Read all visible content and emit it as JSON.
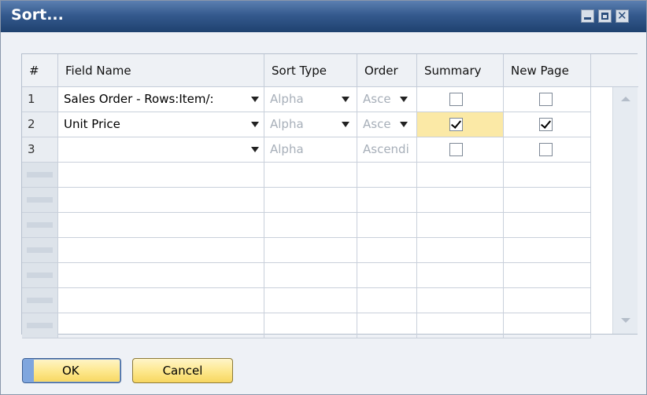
{
  "window": {
    "title": "Sort..."
  },
  "grid": {
    "columns": [
      "#",
      "Field Name",
      "Sort Type",
      "Order",
      "Summary",
      "New Page"
    ],
    "rows": [
      {
        "num": "1",
        "field": "Sales Order - Rows:Item/:",
        "sort_type": "Alpha",
        "order": "Asce",
        "summary": false,
        "new_page": false
      },
      {
        "num": "2",
        "field": "Unit Price",
        "sort_type": "Alpha",
        "order": "Asce",
        "summary": true,
        "new_page": true
      },
      {
        "num": "3",
        "field": "",
        "sort_type": "Alpha",
        "order": "Ascendi",
        "summary": false,
        "new_page": false
      }
    ],
    "empty_row_count": 7
  },
  "buttons": {
    "ok": "OK",
    "cancel": "Cancel"
  },
  "colors": {
    "title_bar": "#355a8e",
    "button_yellow": "#fde78a",
    "highlight": "#fbe9a6"
  }
}
